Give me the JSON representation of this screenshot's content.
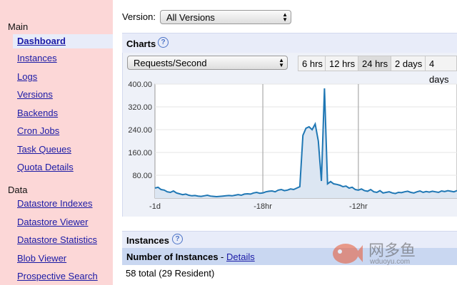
{
  "sidebar": {
    "main_heading": "Main",
    "main_items": [
      "Dashboard",
      "Instances",
      "Logs",
      "Versions",
      "Backends",
      "Cron Jobs",
      "Task Queues",
      "Quota Details"
    ],
    "data_heading": "Data",
    "data_items": [
      "Datastore Indexes",
      "Datastore Viewer",
      "Datastore Statistics",
      "Blob Viewer",
      "Prospective Search"
    ]
  },
  "version": {
    "label": "Version:",
    "selected": "All Versions"
  },
  "charts": {
    "title": "Charts",
    "help": "?",
    "metric_selected": "Requests/Second",
    "ranges": [
      "6 hrs",
      "12 hrs",
      "24 hrs",
      "2 days",
      "4 days"
    ],
    "selected_range": "24 hrs"
  },
  "chart_data": {
    "type": "area",
    "title": "",
    "xlabel": "",
    "ylabel": "",
    "y_ticks": [
      "400.00",
      "320.00",
      "240.00",
      "160.00",
      "80.00"
    ],
    "x_ticks": [
      "-1d",
      "-18hr",
      "-12hr"
    ],
    "ylim": [
      0,
      400
    ],
    "grid": true,
    "series_color": "#1f77b4",
    "fill_color": "#dce6f2",
    "x": [
      0,
      0.5,
      1,
      1.5,
      2,
      2.5,
      3,
      3.5,
      4,
      4.5,
      5,
      5.5,
      6,
      6.5,
      7,
      7.5,
      8,
      8.5,
      9,
      9.5,
      10,
      10.5,
      11,
      11.5,
      12,
      12.5,
      13,
      13.5,
      14,
      14.5,
      15,
      15.5,
      16,
      16.5,
      17,
      17.5,
      18,
      18.5,
      19,
      19.5,
      20,
      20.5,
      21,
      21.5,
      22,
      22.5,
      23,
      23.5,
      24,
      24.5,
      25,
      25.5,
      26,
      26.5,
      27,
      27.5,
      28,
      28.5,
      29,
      29.5,
      30,
      30.5,
      31,
      31.5,
      32,
      32.5,
      33,
      33.5,
      34,
      34.5,
      35,
      35.5,
      36,
      36.5,
      37,
      37.5,
      38,
      38.5,
      39,
      39.5,
      40,
      40.5,
      41,
      41.5,
      42,
      42.5,
      43,
      43.5,
      44,
      44.5,
      45,
      45.5,
      46,
      46.5,
      47,
      47.5,
      48,
      48.5,
      49
    ],
    "values": [
      35,
      38,
      30,
      28,
      22,
      20,
      25,
      18,
      15,
      12,
      14,
      10,
      8,
      9,
      7,
      6,
      8,
      10,
      7,
      6,
      5,
      6,
      7,
      8,
      9,
      8,
      10,
      12,
      10,
      14,
      15,
      14,
      18,
      20,
      17,
      18,
      22,
      24,
      25,
      22,
      28,
      30,
      26,
      28,
      32,
      30,
      35,
      40,
      220,
      245,
      250,
      240,
      260,
      200,
      60,
      385,
      50,
      58,
      50,
      48,
      45,
      40,
      42,
      35,
      38,
      30,
      28,
      32,
      26,
      24,
      30,
      22,
      20,
      26,
      18,
      20,
      22,
      18,
      16,
      20,
      19,
      22,
      24,
      20,
      18,
      22,
      25,
      20,
      23,
      21,
      24,
      22,
      20,
      25,
      23,
      26,
      24,
      22,
      26
    ]
  },
  "instances": {
    "title": "Instances",
    "help": "?",
    "sub_label": "Number of Instances",
    "sub_sep": "-",
    "details_link": "Details",
    "total": "58 total (29 Resident)"
  },
  "watermark": {
    "text": "网多鱼",
    "url": "wduoyu.com"
  }
}
